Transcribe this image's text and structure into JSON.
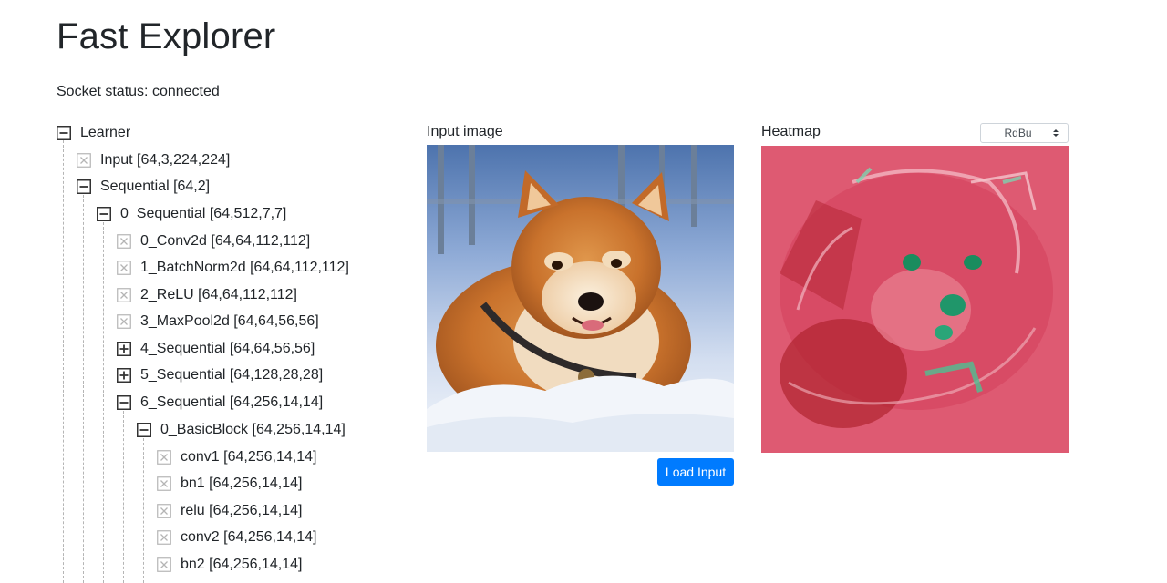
{
  "app": {
    "title": "Fast Explorer",
    "socket_status": "Socket status: connected"
  },
  "tree": {
    "nodes": [
      {
        "label": "Learner",
        "state": "expanded"
      },
      {
        "label": "Input [64,3,224,224]",
        "state": "leaf"
      },
      {
        "label": "Sequential [64,2]",
        "state": "expanded"
      },
      {
        "label": "0_Sequential [64,512,7,7]",
        "state": "expanded"
      },
      {
        "label": "0_Conv2d [64,64,112,112]",
        "state": "leaf"
      },
      {
        "label": "1_BatchNorm2d [64,64,112,112]",
        "state": "leaf"
      },
      {
        "label": "2_ReLU [64,64,112,112]",
        "state": "leaf"
      },
      {
        "label": "3_MaxPool2d [64,64,56,56]",
        "state": "leaf"
      },
      {
        "label": "4_Sequential [64,64,56,56]",
        "state": "collapsed"
      },
      {
        "label": "5_Sequential [64,128,28,28]",
        "state": "collapsed"
      },
      {
        "label": "6_Sequential [64,256,14,14]",
        "state": "expanded"
      },
      {
        "label": "0_BasicBlock [64,256,14,14]",
        "state": "expanded"
      },
      {
        "label": "conv1 [64,256,14,14]",
        "state": "leaf"
      },
      {
        "label": "bn1 [64,256,14,14]",
        "state": "leaf"
      },
      {
        "label": "relu [64,256,14,14]",
        "state": "leaf"
      },
      {
        "label": "conv2 [64,256,14,14]",
        "state": "leaf"
      },
      {
        "label": "bn2 [64,256,14,14]",
        "state": "leaf"
      }
    ]
  },
  "input_panel": {
    "label": "Input image",
    "load_button": "Load Input"
  },
  "heatmap_panel": {
    "label": "Heatmap",
    "colormap": "RdBu"
  },
  "colors": {
    "accent": "#007bff",
    "heatmap_high": "#c0102a",
    "heatmap_low": "#0e8a5a"
  }
}
